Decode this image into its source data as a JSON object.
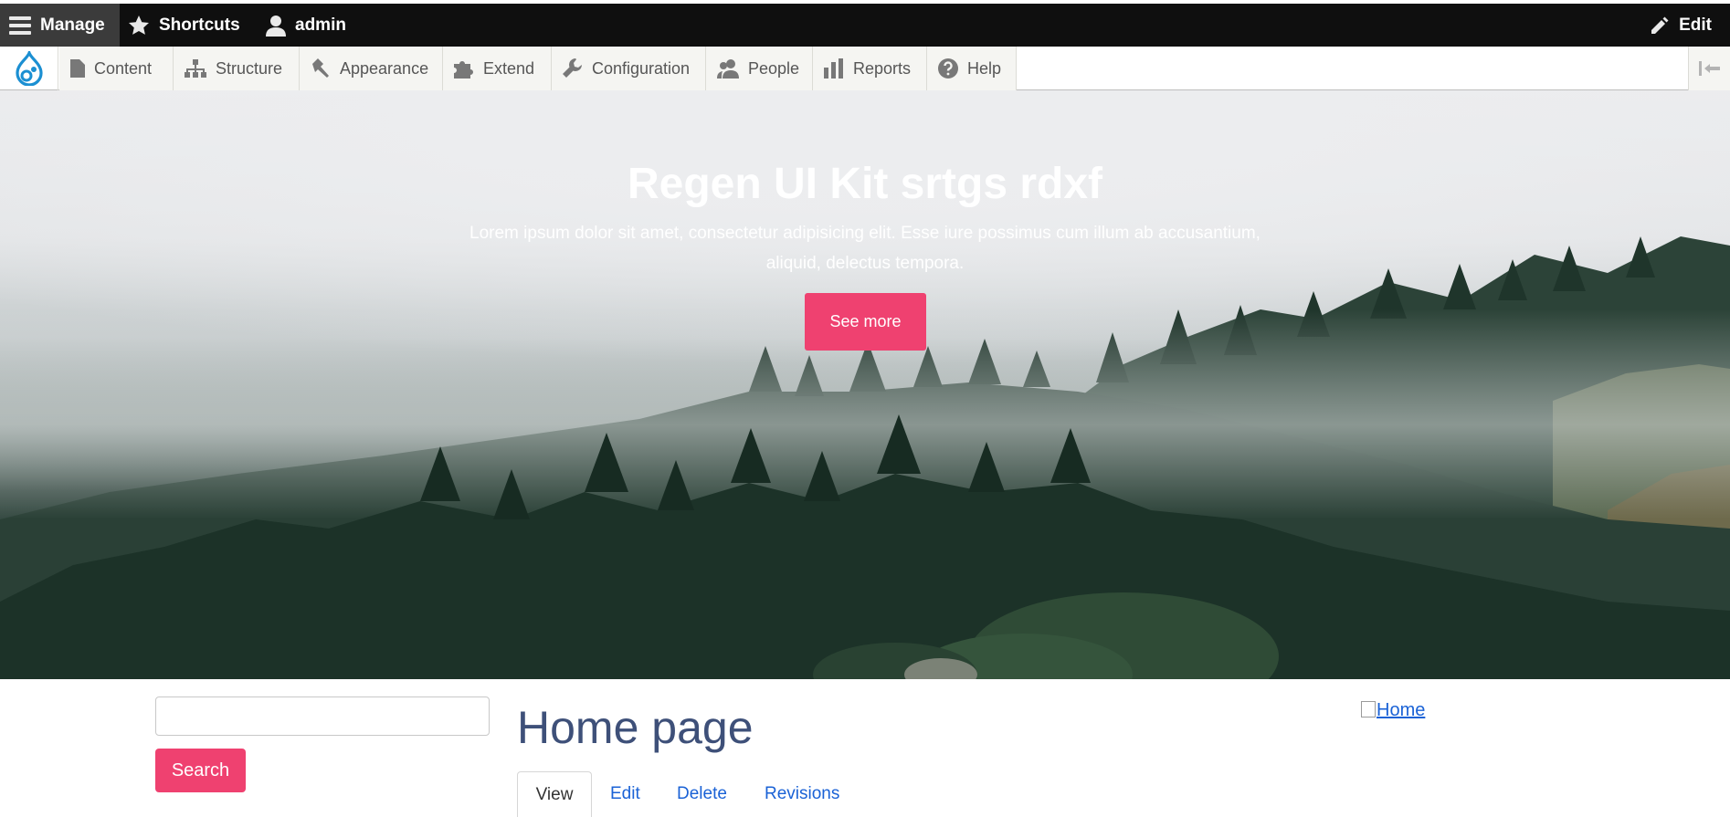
{
  "toolbar": {
    "manage": "Manage",
    "shortcuts": "Shortcuts",
    "user": "admin",
    "edit": "Edit"
  },
  "tray": {
    "logo_icon": "drupal-drop-icon",
    "items": [
      {
        "label": "Content",
        "icon": "file-icon"
      },
      {
        "label": "Structure",
        "icon": "sitemap-icon"
      },
      {
        "label": "Appearance",
        "icon": "paintbrush-icon"
      },
      {
        "label": "Extend",
        "icon": "puzzle-icon"
      },
      {
        "label": "Configuration",
        "icon": "wrench-icon"
      },
      {
        "label": "People",
        "icon": "people-icon"
      },
      {
        "label": "Reports",
        "icon": "bar-chart-icon"
      },
      {
        "label": "Help",
        "icon": "question-icon"
      }
    ],
    "collapse_icon": "collapse-icon"
  },
  "hero": {
    "title": "Regen UI Kit srtgs rdxf",
    "text": "Lorem ipsum dolor sit amet, consectetur adipisicing elit. Esse iure possimus cum illum ab accusantium, aliquid, delectus tempora.",
    "button": "See more"
  },
  "search": {
    "value": "",
    "button": "Search"
  },
  "page": {
    "title": "Home page",
    "home_link": "Home",
    "tabs": [
      "View",
      "Edit",
      "Delete",
      "Revisions"
    ],
    "active_tab": "View"
  },
  "colors": {
    "accent": "#ef4170",
    "title": "#3e5079",
    "link": "#1a62d6",
    "toolbar": "#0f0f0f"
  }
}
